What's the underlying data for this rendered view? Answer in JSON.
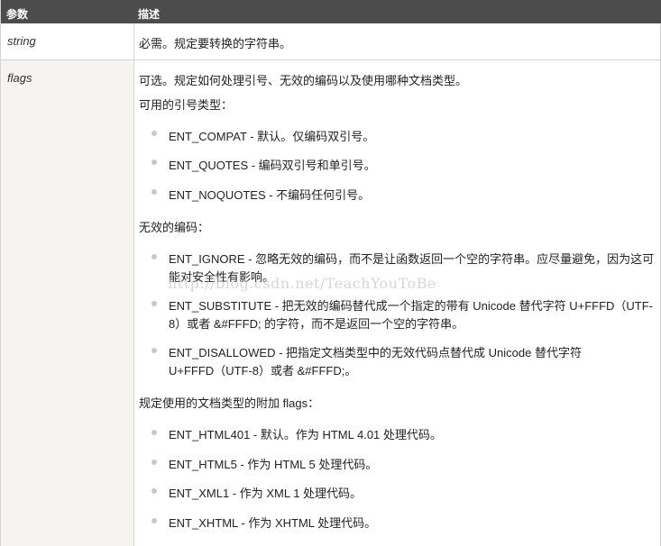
{
  "header": {
    "param_label": "参数",
    "desc_label": "描述"
  },
  "rows": [
    {
      "param": "string",
      "desc": "必需。规定要转换的字符串。"
    },
    {
      "param": "flags",
      "desc": "可选。规定如何处理引号、无效的编码以及使用哪种文档类型。"
    }
  ],
  "flags": {
    "quote_types_heading": "可用的引号类型：",
    "quote_types": [
      "ENT_COMPAT - 默认。仅编码双引号。",
      "ENT_QUOTES - 编码双引号和单引号。",
      "ENT_NOQUOTES - 不编码任何引号。"
    ],
    "invalid_heading": "无效的编码：",
    "invalid_encodings": [
      {
        "line1": "ENT_IGNORE - 忽略无效的编码，而不是让函数返回一个空的字符串。应尽量避免，因为这可",
        "line2": "能对安全性有影响。"
      },
      {
        "line1": "ENT_SUBSTITUTE - 把无效的编码替代成一个指定的带有 Unicode 替代字符 U+FFFD（UTF-",
        "line2": "8）或者 &#FFFD; 的字符，而不是返回一个空的字符串。"
      },
      {
        "line1": "ENT_DISALLOWED - 把指定文档类型中的无效代码点替代成 Unicode 替代字符",
        "line2": "U+FFFD（UTF-8）或者 &#FFFD;。"
      }
    ],
    "doctype_heading": "规定使用的文档类型的附加 flags：",
    "doctypes": [
      "ENT_HTML401 - 默认。作为 HTML 4.01 处理代码。",
      "ENT_HTML5 - 作为 HTML 5 处理代码。",
      "ENT_XML1 - 作为 XML 1 处理代码。",
      "ENT_XHTML - 作为 XHTML 处理代码。"
    ]
  },
  "watermark": "http://blog.csdn.net/TeachYouToBe"
}
